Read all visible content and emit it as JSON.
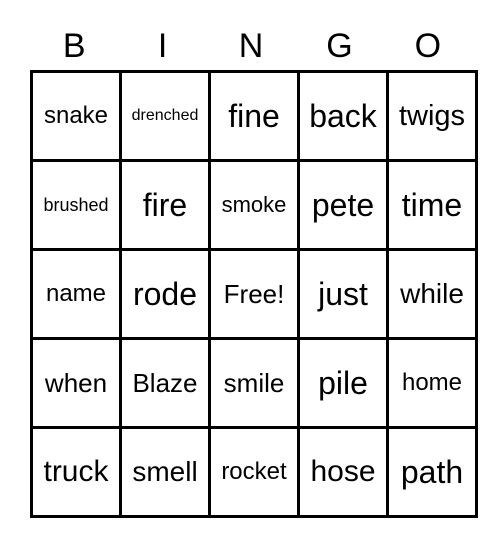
{
  "header": [
    "B",
    "I",
    "N",
    "G",
    "O"
  ],
  "grid": [
    [
      "snake",
      "drenched",
      "fine",
      "back",
      "twigs"
    ],
    [
      "brushed",
      "fire",
      "smoke",
      "pete",
      "time"
    ],
    [
      "name",
      "rode",
      "Free!",
      "just",
      "while"
    ],
    [
      "when",
      "Blaze",
      "smile",
      "pile",
      "home"
    ],
    [
      "truck",
      "smell",
      "rocket",
      "hose",
      "path"
    ]
  ]
}
